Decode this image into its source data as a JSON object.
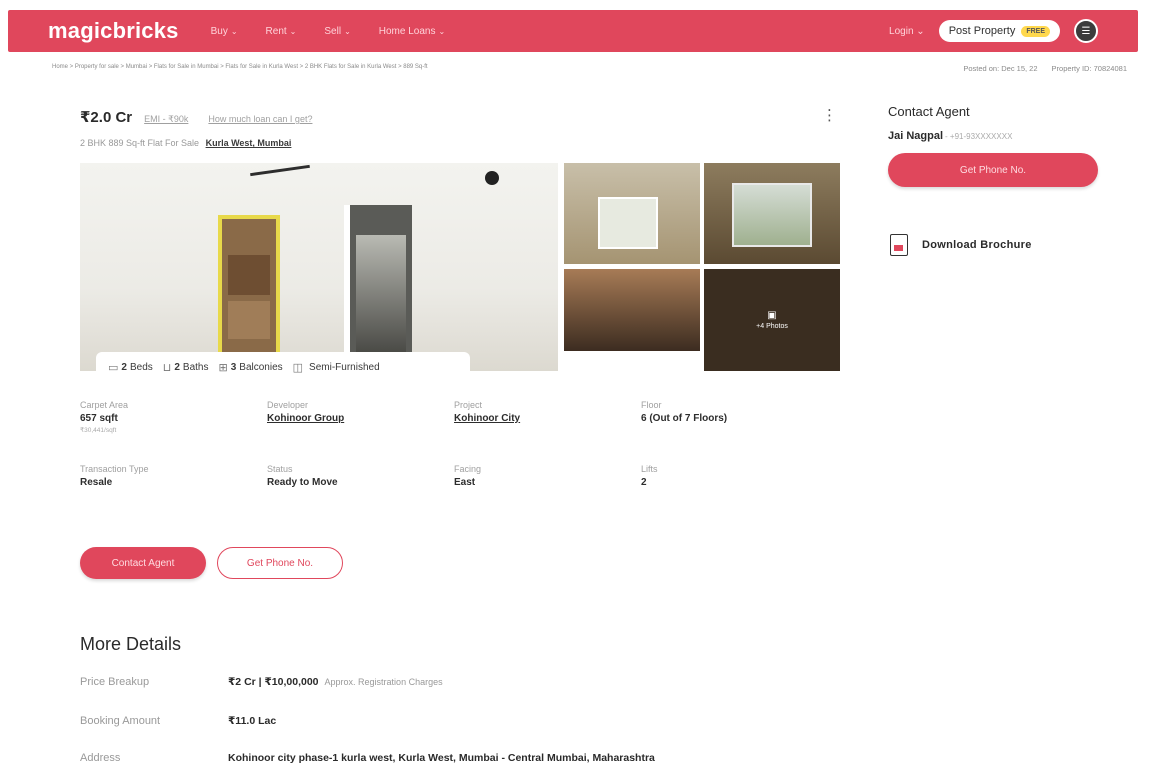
{
  "header": {
    "logo": "magicbricks",
    "nav": [
      {
        "label": "Buy"
      },
      {
        "label": "Rent"
      },
      {
        "label": "Sell"
      },
      {
        "label": "Home Loans"
      }
    ],
    "login": "Login",
    "post_property": "Post Property",
    "free_badge": "FREE"
  },
  "breadcrumb": "Home > Property for sale > Mumbai > Flats for Sale in Mumbai > Flats for Sale in Kurla West > 2 BHK Flats for Sale in Kurla West > 889 Sq-ft",
  "meta": {
    "posted": "Posted on: Dec 15, 22",
    "property_id": "Property ID: 70824081"
  },
  "listing": {
    "price": "₹2.0 Cr",
    "emi": "EMI - ₹90k",
    "loan_link": "How much loan can I get?",
    "subtitle": "2 BHK 889 Sq-ft Flat For Sale",
    "location": "Kurla West, Mumbai",
    "photo_count": "+4 Photos"
  },
  "amenities": [
    {
      "num": "2",
      "label": "Beds",
      "icon": "bed-icon"
    },
    {
      "num": "2",
      "label": "Baths",
      "icon": "bath-icon"
    },
    {
      "num": "3",
      "label": "Balconies",
      "icon": "balcony-icon"
    },
    {
      "num": "",
      "label": "Semi-Furnished",
      "icon": "furnish-icon"
    }
  ],
  "info": {
    "carpet_area": {
      "label": "Carpet Area",
      "value": "657 sqft",
      "sub": "₹30,441/sqft"
    },
    "developer": {
      "label": "Developer",
      "value": "Kohinoor Group"
    },
    "project": {
      "label": "Project",
      "value": "Kohinoor City"
    },
    "floor": {
      "label": "Floor",
      "value": "6 (Out of 7 Floors)"
    },
    "transaction": {
      "label": "Transaction Type",
      "value": "Resale"
    },
    "status": {
      "label": "Status",
      "value": "Ready to Move"
    },
    "facing": {
      "label": "Facing",
      "value": "East"
    },
    "lifts": {
      "label": "Lifts",
      "value": "2"
    }
  },
  "buttons": {
    "contact_agent": "Contact Agent",
    "get_phone": "Get Phone No."
  },
  "more_details": {
    "title": "More Details",
    "price_breakup": {
      "label": "Price Breakup",
      "value": "₹2 Cr | ₹10,00,000",
      "extra": "Approx. Registration Charges"
    },
    "booking": {
      "label": "Booking Amount",
      "value": "₹11.0 Lac"
    },
    "address": {
      "label": "Address",
      "value": "Kohinoor city phase-1 kurla west, Kurla West, Mumbai - Central Mumbai, Maharashtra"
    }
  },
  "sidebar": {
    "title": "Contact Agent",
    "agent_name": "Jai Nagpal",
    "agent_phone": "- +91-93XXXXXXX",
    "phone_button": "Get Phone No.",
    "brochure": "Download Brochure"
  },
  "colors": {
    "brand": "#e0475c"
  }
}
